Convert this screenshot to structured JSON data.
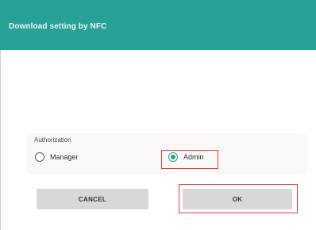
{
  "dialog": {
    "title": "Download setting by NFC"
  },
  "authorization": {
    "label": "Authorization",
    "options": [
      {
        "label": "Manager",
        "selected": false
      },
      {
        "label": "Admin",
        "selected": true
      }
    ]
  },
  "buttons": {
    "cancel_label": "CANCEL",
    "ok_label": "OK"
  },
  "colors": {
    "accent": "#27a195",
    "highlight": "#e53935",
    "button_bg": "#d9d8d8"
  }
}
